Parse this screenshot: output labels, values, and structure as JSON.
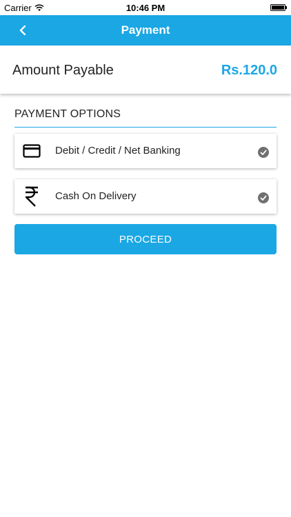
{
  "status_bar": {
    "carrier": "Carrier",
    "time": "10:46 PM"
  },
  "nav": {
    "title": "Payment",
    "back_icon": "chevron-left-icon"
  },
  "amount": {
    "label": "Amount Payable",
    "value": "Rs.120.0"
  },
  "payment_options": {
    "title": "PAYMENT OPTIONS",
    "items": [
      {
        "label": "Debit / Credit / Net Banking",
        "icon": "credit-card-icon",
        "selected": true
      },
      {
        "label": "Cash On Delivery",
        "icon": "rupee-icon",
        "selected": true
      }
    ]
  },
  "proceed_label": "PROCEED",
  "colors": {
    "accent": "#1aa7e4",
    "check": "#707070"
  }
}
